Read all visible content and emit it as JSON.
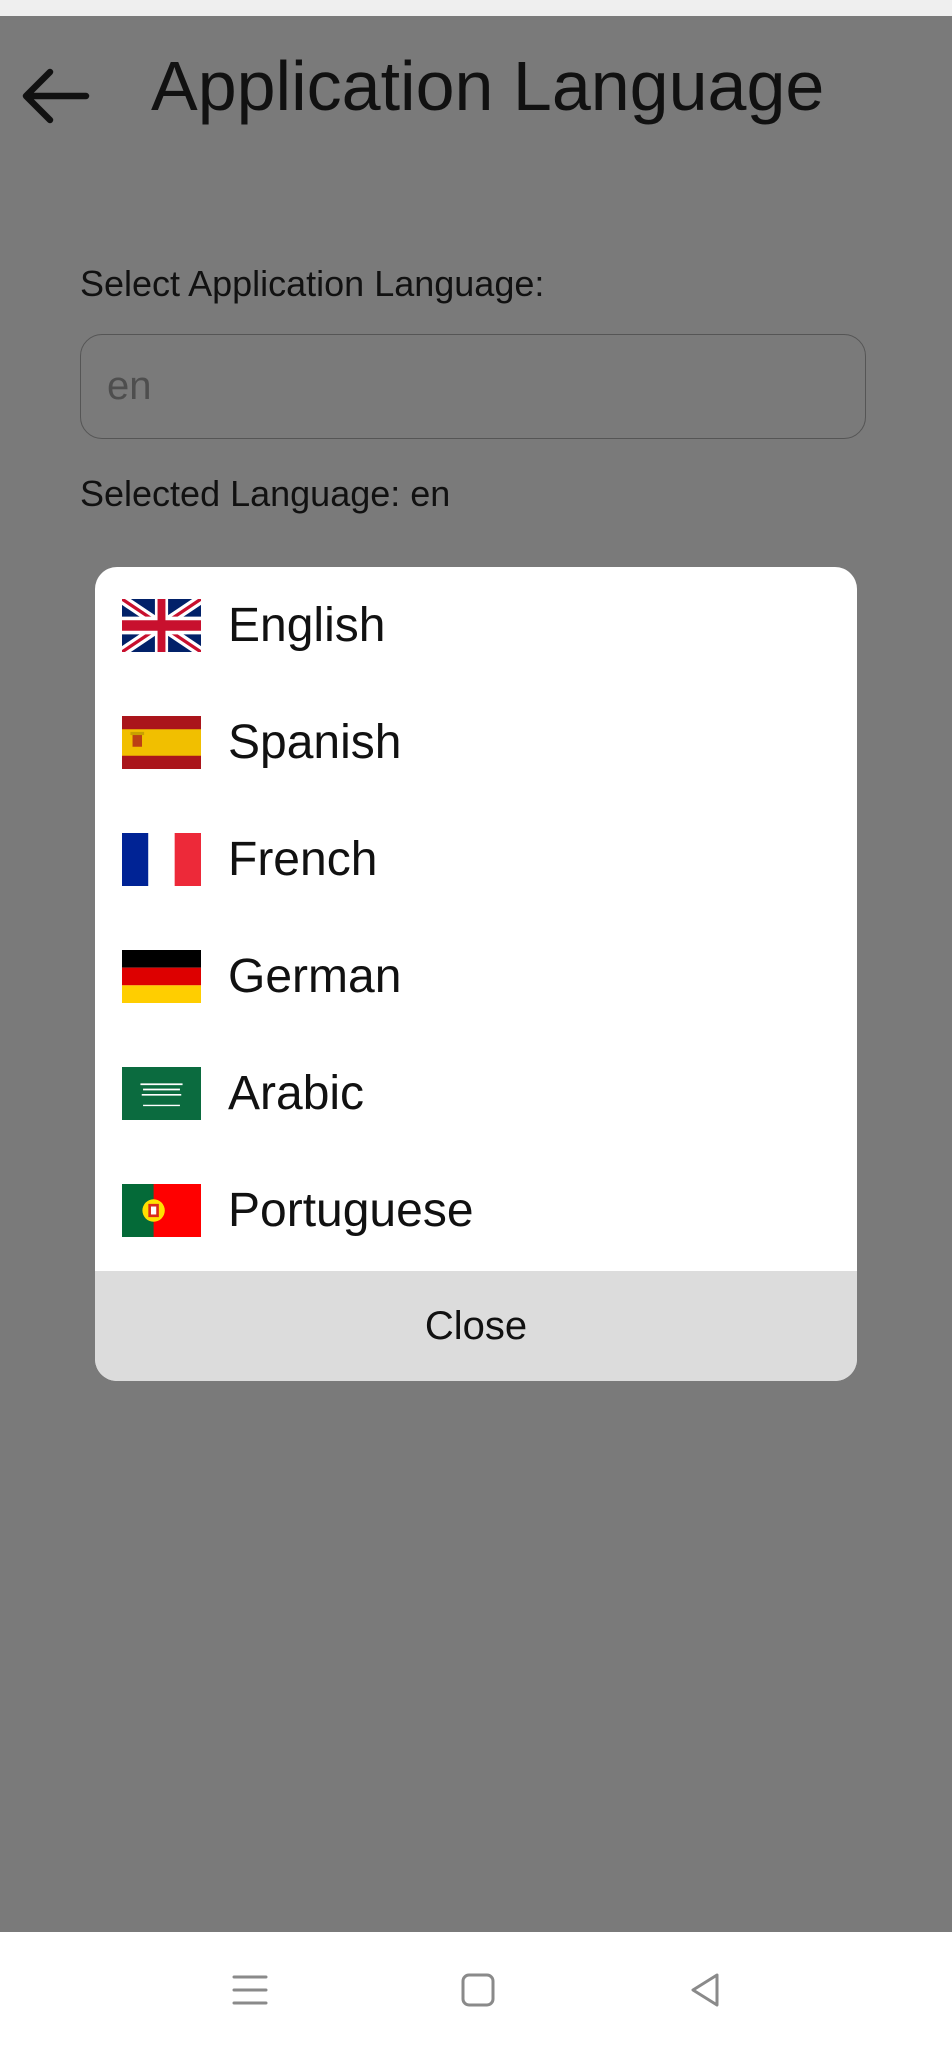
{
  "header": {
    "title": "Application Language",
    "back_icon": "arrow-left-icon"
  },
  "form": {
    "select_label": "Select Application Language:",
    "input_value": "en",
    "selected_prefix": "Selected Language: ",
    "selected_value": "en"
  },
  "dialog": {
    "languages": [
      {
        "name": "English",
        "flag_icon": "uk-flag-icon"
      },
      {
        "name": "Spanish",
        "flag_icon": "spain-flag-icon"
      },
      {
        "name": "French",
        "flag_icon": "france-flag-icon"
      },
      {
        "name": "German",
        "flag_icon": "germany-flag-icon"
      },
      {
        "name": "Arabic",
        "flag_icon": "saudi-arabia-flag-icon"
      },
      {
        "name": "Portuguese",
        "flag_icon": "portugal-flag-icon"
      }
    ],
    "close_label": "Close"
  },
  "nav": {
    "icons": [
      "menu-icon",
      "home-square-icon",
      "back-triangle-icon"
    ]
  },
  "colors": {
    "overlay": "#7a7a7a",
    "dialog_bg": "#ffffff",
    "close_bg": "#dcdcdc",
    "nav_bg": "#ffffff"
  }
}
